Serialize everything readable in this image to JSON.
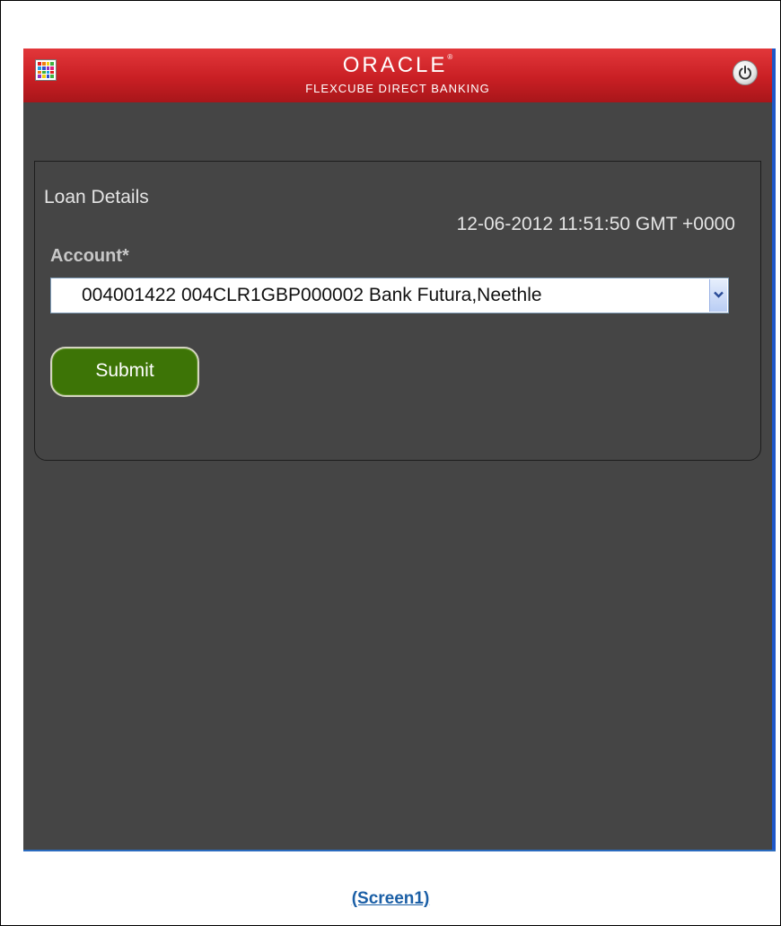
{
  "header": {
    "brand": "ORACLE",
    "brand_mark": "®",
    "product": "FLEXCUBE DIRECT BANKING",
    "menu_icon": "app-grid-icon",
    "logout_icon": "power-icon",
    "accent": "#c91f24"
  },
  "panel": {
    "title": "Loan Details",
    "timestamp": "12-06-2012 11:51:50 GMT +0000",
    "account_label": "Account*",
    "account_value": "004001422 004CLR1GBP000002 Bank Futura,Neethle",
    "submit_label": "Submit",
    "submit_color": "#3d7406"
  },
  "caption": "(Screen1)"
}
